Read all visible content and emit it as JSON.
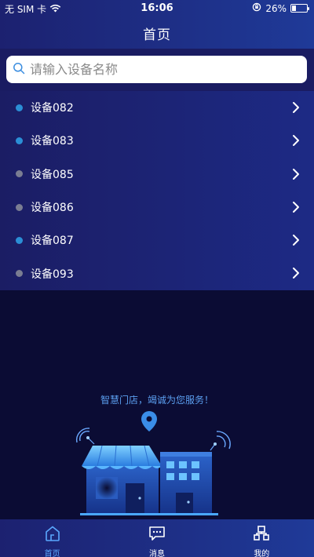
{
  "status_bar": {
    "carrier": "无 SIM 卡",
    "time": "16:06",
    "battery": "26%",
    "battery_level": 0.26
  },
  "header": {
    "title": "首页"
  },
  "search": {
    "placeholder": "请输入设备名称",
    "value": ""
  },
  "devices": [
    {
      "label": "设备082",
      "online": true
    },
    {
      "label": "设备083",
      "online": true
    },
    {
      "label": "设备085",
      "online": false
    },
    {
      "label": "设备086",
      "online": false
    },
    {
      "label": "设备087",
      "online": true
    },
    {
      "label": "设备093",
      "online": false
    }
  ],
  "hero": {
    "slogan": "智慧门店，竭诚为您服务！"
  },
  "tabs": [
    {
      "label": "首页",
      "icon": "home-icon",
      "active": true
    },
    {
      "label": "消息",
      "icon": "message-icon",
      "active": false
    },
    {
      "label": "我的",
      "icon": "profile-icon",
      "active": false
    }
  ],
  "colors": {
    "online_dot": "#2b8fd6",
    "offline_dot": "#7a7d92",
    "active_tab": "#5aa8ff",
    "slogan": "#5b9ff0"
  }
}
